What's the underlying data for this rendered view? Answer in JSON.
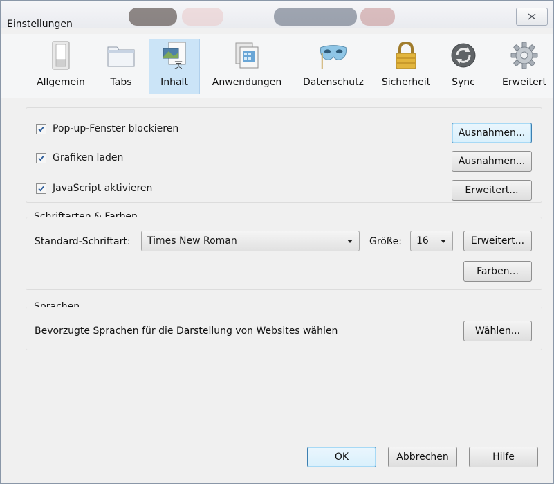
{
  "window": {
    "title": "Einstellungen",
    "close_icon": "close-icon"
  },
  "toolbar": {
    "items": [
      {
        "label": "Allgemein",
        "icon": "switch-icon"
      },
      {
        "label": "Tabs",
        "icon": "tabs-icon"
      },
      {
        "label": "Inhalt",
        "icon": "content-page-icon"
      },
      {
        "label": "Anwendungen",
        "icon": "applications-icon"
      },
      {
        "label": "Datenschutz",
        "icon": "mask-icon"
      },
      {
        "label": "Sicherheit",
        "icon": "padlock-icon"
      },
      {
        "label": "Sync",
        "icon": "sync-icon"
      },
      {
        "label": "Erweitert",
        "icon": "gear-icon"
      }
    ],
    "active": "Inhalt"
  },
  "content_group": {
    "popup_label": "Pop-up-Fenster blockieren",
    "popup_checked": true,
    "images_label": "Grafiken laden",
    "images_checked": true,
    "javascript_label": "JavaScript aktivieren",
    "javascript_checked": true,
    "popup_exceptions_button": "Ausnahmen...",
    "images_exceptions_button": "Ausnahmen...",
    "javascript_advanced_button": "Erweitert..."
  },
  "fonts_group": {
    "legend": "Schriftarten & Farben",
    "default_font_label": "Standard-Schriftart:",
    "default_font_value": "Times New Roman",
    "size_label": "Größe:",
    "size_value": "16",
    "advanced_button": "Erweitert...",
    "colors_button": "Farben..."
  },
  "languages_group": {
    "legend": "Sprachen",
    "description": "Bevorzugte Sprachen für die Darstellung von Websites wählen",
    "choose_button": "Wählen..."
  },
  "footer": {
    "ok_button": "OK",
    "cancel_button": "Abbrechen",
    "help_button": "Hilfe"
  },
  "colors": {
    "active_tab": "#cbe4f7",
    "focused_button_border": "#3c7fb1",
    "checkbox_check": "#2b5c9a"
  }
}
